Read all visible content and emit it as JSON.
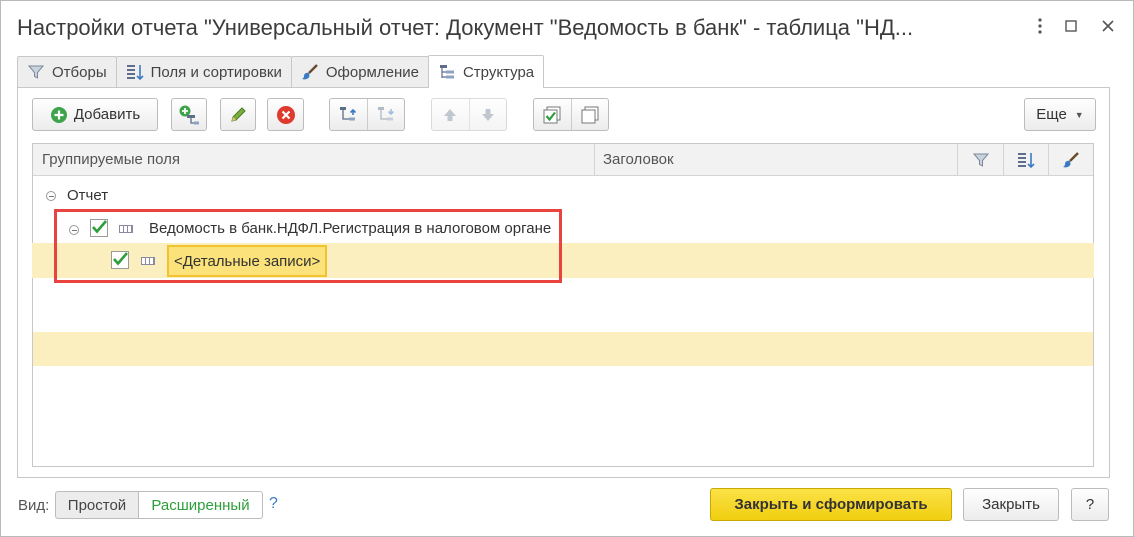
{
  "window": {
    "title": "Настройки отчета \"Универсальный отчет: Документ \"Ведомость в банк\" - таблица \"НД...",
    "controls": [
      "more",
      "maximize",
      "close"
    ]
  },
  "tabs": [
    {
      "label": "Отборы",
      "icon": "filter-icon",
      "active": false
    },
    {
      "label": "Поля и сортировки",
      "icon": "fields-sort-icon",
      "active": false
    },
    {
      "label": "Оформление",
      "icon": "brush-icon",
      "active": false
    },
    {
      "label": "Структура",
      "icon": "structure-icon",
      "active": true
    }
  ],
  "toolbar": {
    "add_label": "Добавить",
    "more_label": "Еще",
    "icons": [
      "add-group-icon",
      "edit-icon",
      "delete-icon",
      "move-up-level-icon",
      "move-down-level-icon",
      "move-up-icon",
      "move-down-icon",
      "check-all-icon",
      "uncheck-all-icon"
    ]
  },
  "grid": {
    "columns": [
      "Группируемые поля",
      "Заголовок"
    ],
    "header_icons": [
      "filter-icon",
      "fields-sort-icon",
      "brush-icon"
    ],
    "rows": [
      {
        "label": "Отчет",
        "level": 0,
        "has_toggle": true,
        "checked": null
      },
      {
        "label": "Ведомость в банк.НДФЛ.Регистрация в налоговом органе",
        "level": 1,
        "has_toggle": true,
        "checked": true
      },
      {
        "label": "<Детальные записи>",
        "level": 2,
        "has_toggle": false,
        "checked": true,
        "selected": true
      }
    ]
  },
  "footer": {
    "view_label": "Вид:",
    "view_simple": "Простой",
    "view_extended": "Расширенный",
    "help": "?",
    "generate_label": "Закрыть и сформировать",
    "close_label": "Закрыть",
    "help_button": "?"
  },
  "colors": {
    "accent_yellow": "#f1ce10",
    "selection": "#fbefc0",
    "highlight_frame": "#e8433f",
    "check_green": "#2e9e3a",
    "delete_red": "#e03a2e",
    "link_blue": "#3c7bc4"
  }
}
